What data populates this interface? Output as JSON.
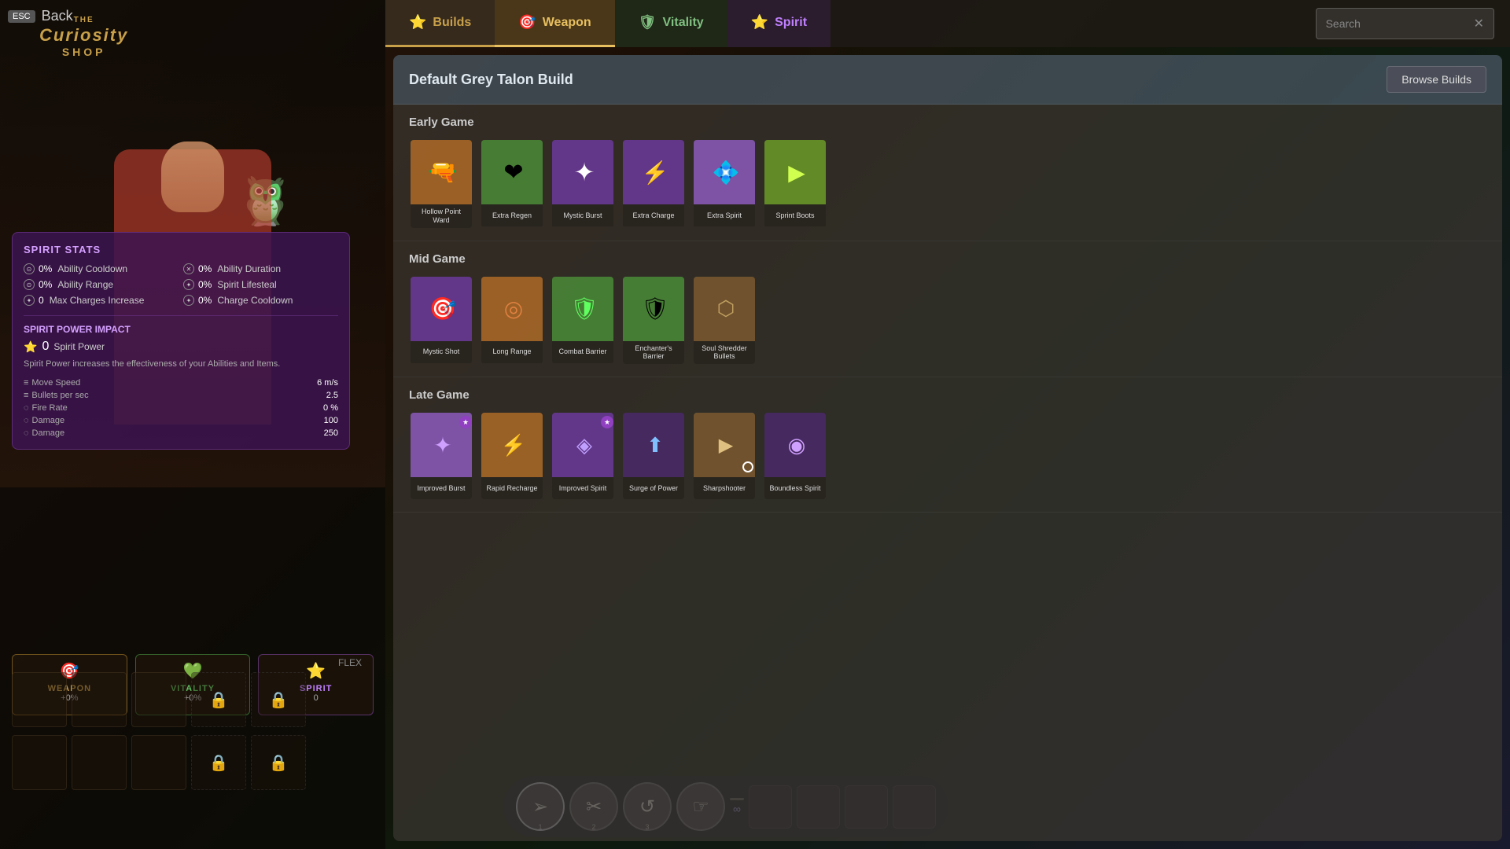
{
  "app": {
    "title": "The Curiosity Shop",
    "back_label": "Back",
    "esc_label": "ESC"
  },
  "tabs": [
    {
      "id": "builds",
      "label": "Builds",
      "icon": "⭐",
      "active": true
    },
    {
      "id": "weapon",
      "label": "Weapon",
      "icon": "🎯",
      "active": false
    },
    {
      "id": "vitality",
      "label": "Vitality",
      "icon": "🛡",
      "active": false
    },
    {
      "id": "spirit",
      "label": "Spirit",
      "icon": "⭐",
      "active": false
    }
  ],
  "search": {
    "placeholder": "Search",
    "value": ""
  },
  "build": {
    "title": "Default Grey Talon Build",
    "browse_builds_label": "Browse Builds"
  },
  "sections": [
    {
      "id": "early-game",
      "title": "Early Game",
      "items": [
        {
          "id": "hollow-point-ward",
          "name": "Hollow Point Ward",
          "color": "orange",
          "icon": "🔫",
          "badge": null
        },
        {
          "id": "extra-regen",
          "name": "Extra Regen",
          "color": "green",
          "icon": "💚",
          "badge": null
        },
        {
          "id": "mystic-burst",
          "name": "Mystic Burst",
          "color": "purple",
          "icon": "✦",
          "badge": null
        },
        {
          "id": "extra-charge",
          "name": "Extra Charge",
          "color": "purple",
          "icon": "⚡",
          "badge": null
        },
        {
          "id": "extra-spirit",
          "name": "Extra Spirit",
          "color": "light-purple",
          "icon": "💠",
          "badge": null
        },
        {
          "id": "sprint-boots",
          "name": "Sprint Boots",
          "color": "lime",
          "icon": "▶",
          "badge": null
        }
      ]
    },
    {
      "id": "mid-game",
      "title": "Mid Game",
      "items": [
        {
          "id": "mystic-shot",
          "name": "Mystic Shot",
          "color": "purple",
          "icon": "🎯",
          "badge": null
        },
        {
          "id": "long-range",
          "name": "Long Range",
          "color": "orange",
          "icon": "◎",
          "badge": null
        },
        {
          "id": "combat-barrier",
          "name": "Combat Barrier",
          "color": "green",
          "icon": "🛡",
          "badge": null
        },
        {
          "id": "enchanters-barrier",
          "name": "Enchanter's Barrier",
          "color": "green",
          "icon": "🛡",
          "badge": null
        },
        {
          "id": "soul-shredder-bullets",
          "name": "Soul Shredder Bullets",
          "color": "brown",
          "icon": "⬡",
          "badge": null
        }
      ]
    },
    {
      "id": "late-game",
      "title": "Late Game",
      "items": [
        {
          "id": "improved-burst",
          "name": "Improved Burst",
          "color": "light-purple",
          "icon": "✦",
          "badge": "spirit"
        },
        {
          "id": "rapid-recharge",
          "name": "Rapid Recharge",
          "color": "orange",
          "icon": "⚡",
          "badge": null
        },
        {
          "id": "improved-spirit",
          "name": "Improved Spirit",
          "color": "purple",
          "icon": "◈",
          "badge": "spirit"
        },
        {
          "id": "surge-of-power",
          "name": "Surge of Power",
          "color": "dark-purple",
          "icon": "⬆",
          "badge": null
        },
        {
          "id": "sharpshooter",
          "name": "Sharpshooter",
          "color": "brown",
          "icon": "▶",
          "badge": null
        },
        {
          "id": "boundless-spirit",
          "name": "Boundless Spirit",
          "color": "dark-purple",
          "icon": "◉",
          "badge": null
        }
      ]
    }
  ],
  "spirit_stats": {
    "title": "SPIRIT STATS",
    "stats": [
      {
        "id": "ability-cooldown",
        "label": "Ability Cooldown",
        "value": "0%",
        "icon": "⊙"
      },
      {
        "id": "ability-duration",
        "label": "Ability Duration",
        "value": "0%",
        "icon": "✕"
      },
      {
        "id": "ability-range",
        "label": "Ability Range",
        "value": "0%",
        "icon": "⊙"
      },
      {
        "id": "spirit-lifesteal",
        "label": "Spirit Lifesteal",
        "value": "0%",
        "icon": "✦"
      },
      {
        "id": "max-charges",
        "label": "Max Charges Increase",
        "value": "0",
        "icon": "✦"
      },
      {
        "id": "charge-cooldown",
        "label": "Charge Cooldown",
        "value": "0%",
        "icon": "✦"
      }
    ],
    "spirit_power_impact": "SPIRIT POWER IMPACT",
    "spirit_power_label": "Spirit Power",
    "spirit_power_value": "0",
    "spirit_power_desc": "Spirit Power increases the effectiveness of your Abilities and Items.",
    "combat_stats": [
      {
        "label": "Move Speed",
        "value": "6 m/s"
      },
      {
        "label": "Bullets per sec",
        "value": "2.5"
      },
      {
        "label": "Fire Rate",
        "value": "0 %"
      },
      {
        "label": "Damage",
        "value": "100"
      },
      {
        "label": "Damage",
        "value": "250"
      }
    ]
  },
  "bottom_bars": [
    {
      "id": "weapon",
      "label": "WEAPON",
      "pct": "+0%",
      "icon": "🎯",
      "class": "weapon"
    },
    {
      "id": "vitality",
      "label": "VITALITY",
      "pct": "+0%",
      "icon": "💚",
      "class": "vitality"
    },
    {
      "id": "spirit",
      "label": "SPIRIT",
      "pct": "0",
      "icon": "⭐",
      "class": "spirit"
    }
  ],
  "flex_label": "FLEX",
  "abilities": [
    {
      "id": "ability-1",
      "icon": "➢",
      "num": "1"
    },
    {
      "id": "ability-2",
      "icon": "✂",
      "num": "2"
    },
    {
      "id": "ability-3",
      "icon": "↺",
      "num": "3"
    },
    {
      "id": "ability-4",
      "icon": "☞",
      "num": ""
    }
  ]
}
